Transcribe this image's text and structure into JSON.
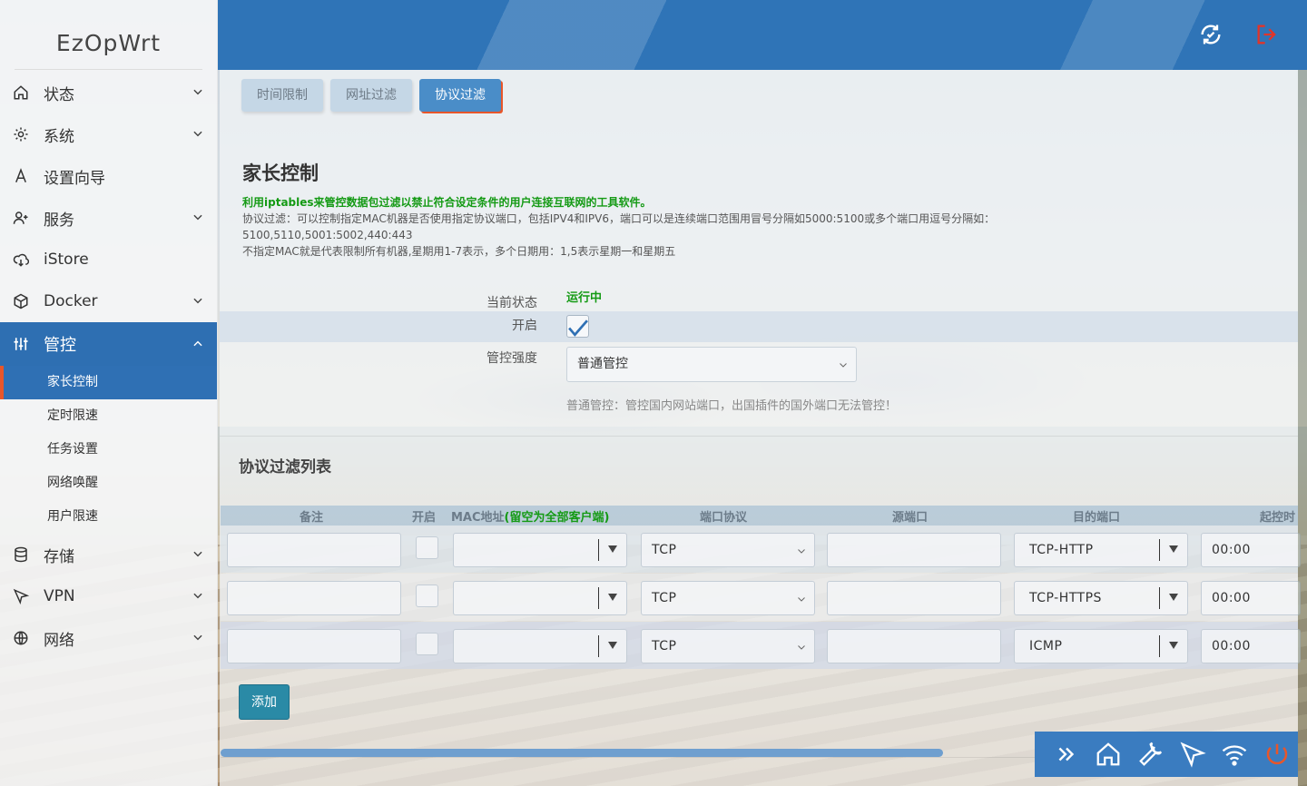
{
  "app": {
    "title": "EzOpWrt"
  },
  "sidebar": {
    "items": [
      {
        "label": "状态",
        "icon": "home-icon",
        "has_children": true
      },
      {
        "label": "系统",
        "icon": "gear-icon",
        "has_children": true
      },
      {
        "label": "设置向导",
        "icon": "wizard-icon",
        "has_children": false
      },
      {
        "label": "服务",
        "icon": "user-plus-icon",
        "has_children": true
      },
      {
        "label": "iStore",
        "icon": "cloud-download-icon",
        "has_children": false
      },
      {
        "label": "Docker",
        "icon": "cube-icon",
        "has_children": true
      },
      {
        "label": "管控",
        "icon": "sliders-icon",
        "has_children": true,
        "expanded": true
      },
      {
        "label": "存储",
        "icon": "database-icon",
        "has_children": true
      },
      {
        "label": "VPN",
        "icon": "send-icon",
        "has_children": true
      },
      {
        "label": "网络",
        "icon": "globe-icon",
        "has_children": true
      }
    ],
    "submenu": [
      {
        "label": "家长控制",
        "active": true
      },
      {
        "label": "定时限速"
      },
      {
        "label": "任务设置"
      },
      {
        "label": "网络唤醒"
      },
      {
        "label": "用户限速"
      }
    ]
  },
  "header": {
    "refresh_icon": "refresh-icon",
    "logout_icon": "logout-icon",
    "logout_color": "#e0352a"
  },
  "tabs": [
    {
      "label": "时间限制"
    },
    {
      "label": "网址过滤"
    },
    {
      "label": "协议过滤",
      "active": true
    }
  ],
  "page": {
    "title": "家长控制",
    "desc_highlight": "利用iptables来管控数据包过滤以禁止符合设定条件的用户连接互联网的工具软件。",
    "desc_line2": "协议过滤：可以控制指定MAC机器是否使用指定协议端口，包括IPV4和IPV6，端口可以是连续端口范围用冒号分隔如5000:5100或多个端口用逗号分隔如：5100,5110,5001:5002,440:443",
    "desc_line3": "不指定MAC就是代表限制所有机器,星期用1-7表示，多个日期用：1,5表示星期一和星期五"
  },
  "form": {
    "status_label": "当前状态",
    "status_value": "运行中",
    "enable_label": "开启",
    "enable_checked": true,
    "strength_label": "管控强度",
    "strength_value": "普通管控",
    "strength_hint": "普通管控：管控国内网站端口，出国插件的国外端口无法管控！"
  },
  "table": {
    "section_title": "协议过滤列表",
    "headers": {
      "remark": "备注",
      "enable": "开启",
      "mac_prefix": "MAC地址",
      "mac_note": "(留空为全部客户端)",
      "protocol": "端口协议",
      "src_port": "源端口",
      "dst_port": "目的端口",
      "start_time": "起控时"
    },
    "rows": [
      {
        "remark": "",
        "enabled": false,
        "mac": "",
        "protocol": "TCP",
        "src_port": "",
        "dst_port": "TCP-HTTP",
        "start_time": "00:00"
      },
      {
        "remark": "",
        "enabled": false,
        "mac": "",
        "protocol": "TCP",
        "src_port": "",
        "dst_port": "TCP-HTTPS",
        "start_time": "00:00"
      },
      {
        "remark": "",
        "enabled": false,
        "mac": "",
        "protocol": "TCP",
        "src_port": "",
        "dst_port": "ICMP",
        "start_time": "00:00"
      }
    ],
    "add_label": "添加"
  },
  "dock": {
    "items": [
      "chevrons-right-icon",
      "home-icon",
      "wrench-icon",
      "send-icon",
      "wifi-icon",
      "power-icon"
    ],
    "power_color": "#e8562a"
  },
  "colors": {
    "accent": "#2f70b4",
    "active_marker": "#e8562a",
    "success": "#149a14",
    "add_button": "#2a8aa6"
  }
}
